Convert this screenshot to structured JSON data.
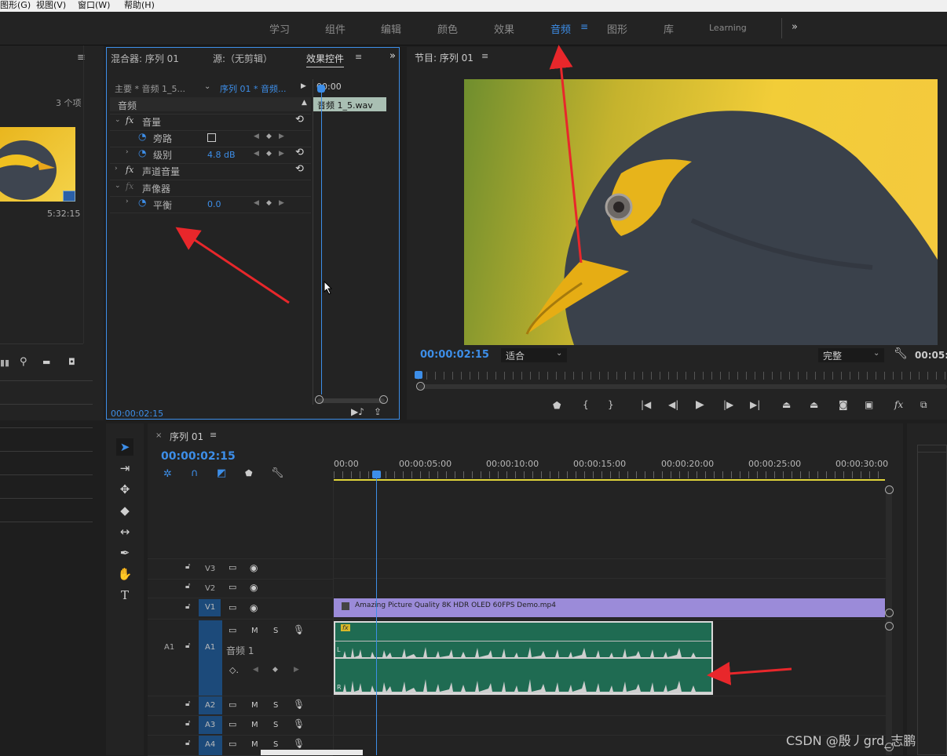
{
  "menubar": {
    "items": [
      "图形(G)",
      "视图(V)",
      "窗口(W)",
      "帮助(H)"
    ]
  },
  "workspaces": {
    "tabs": [
      "学习",
      "组件",
      "编辑",
      "颜色",
      "效果",
      "音频",
      "图形",
      "库",
      "Learning"
    ],
    "active": "音频"
  },
  "project_panel": {
    "count": "3 个项",
    "duration": "5:32:15"
  },
  "effect_controls": {
    "tabs": [
      "混合器: 序列 01",
      "源:（无剪辑）",
      "效果控件"
    ],
    "master": "主要 * 音频 1_5...",
    "sequence": "序列 01 * 音频...",
    "ruler_time": "00:00",
    "clip": "音频 1_5.wav",
    "section": "音频",
    "effects": [
      {
        "label": "音量"
      },
      {
        "label": "旁路"
      },
      {
        "label": "级别",
        "value": "4.8 dB"
      },
      {
        "label": "声道音量"
      },
      {
        "label": "声像器"
      },
      {
        "label": "平衡",
        "value": "0.0"
      }
    ],
    "timecode": "00:00:02:15"
  },
  "program": {
    "title": "节目: 序列 01",
    "timecode": "00:00:02:15",
    "fit": "适合",
    "quality": "完整",
    "end_time": "00:05:"
  },
  "timeline": {
    "title": "序列 01",
    "timecode": "00:00:02:15",
    "ruler": [
      "00:00",
      "00:00:05:00",
      "00:00:10:00",
      "00:00:15:00",
      "00:00:20:00",
      "00:00:25:00",
      "00:00:30:00"
    ],
    "tracks": {
      "v3": "V3",
      "v2": "V2",
      "v1": "V1",
      "a1": "A1",
      "a1_name": "音频 1",
      "a2": "A2",
      "a3": "A3",
      "a4": "A4",
      "m": "M",
      "s": "S"
    },
    "video_clip": "Amazing Picture Quality 8K HDR OLED 60FPS Demo.mp4",
    "audio_fx": "fx"
  },
  "watermark": "CSDN @殷丿grd_志鹏",
  "colors": {
    "accent": "#3d8ee8",
    "video_clip": "#9b8bd9",
    "audio_clip": "#1f6b52",
    "annotation": "#e8272b"
  }
}
